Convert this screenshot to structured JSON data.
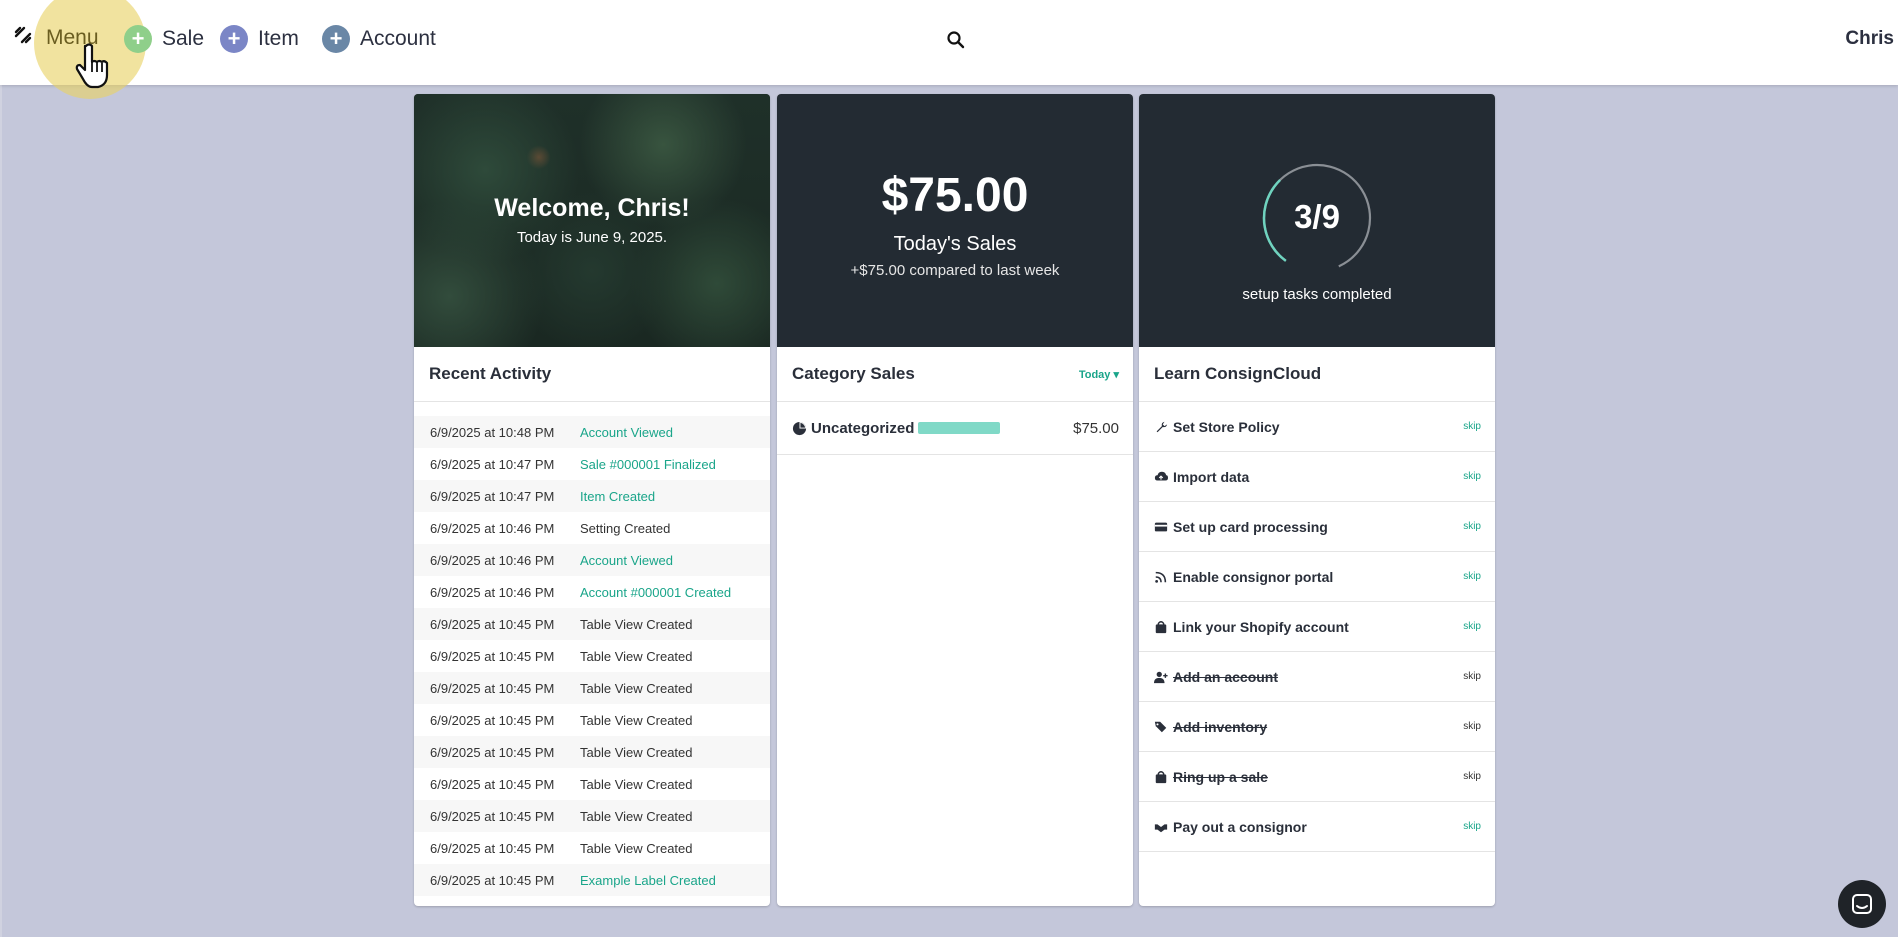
{
  "topbar": {
    "menu_label": "Menu",
    "quick_actions": [
      {
        "label": "Sale",
        "color": "#8fcf8a"
      },
      {
        "label": "Item",
        "color": "#7b86c6"
      },
      {
        "label": "Account",
        "color": "#6a87a6"
      }
    ],
    "user_name": "Chris"
  },
  "welcome": {
    "title": "Welcome, Chris!",
    "subtitle": "Today is June 9, 2025."
  },
  "sales": {
    "amount": "$75.00",
    "label": "Today's Sales",
    "compare": "+$75.00 compared to last week"
  },
  "setup": {
    "progress_text": "3/9",
    "completed": 3,
    "total": 9,
    "caption": "setup tasks completed"
  },
  "recent_activity": {
    "title": "Recent Activity",
    "rows": [
      {
        "date": "6/9/2025 at 10:48 PM",
        "text": "Account Viewed",
        "link": true
      },
      {
        "date": "6/9/2025 at 10:47 PM",
        "text": "Sale #000001 Finalized",
        "link": true
      },
      {
        "date": "6/9/2025 at 10:47 PM",
        "text": "Item Created",
        "link": true
      },
      {
        "date": "6/9/2025 at 10:46 PM",
        "text": "Setting Created",
        "link": false
      },
      {
        "date": "6/9/2025 at 10:46 PM",
        "text": "Account Viewed",
        "link": true
      },
      {
        "date": "6/9/2025 at 10:46 PM",
        "text": "Account #000001 Created",
        "link": true
      },
      {
        "date": "6/9/2025 at 10:45 PM",
        "text": "Table View Created",
        "link": false
      },
      {
        "date": "6/9/2025 at 10:45 PM",
        "text": "Table View Created",
        "link": false
      },
      {
        "date": "6/9/2025 at 10:45 PM",
        "text": "Table View Created",
        "link": false
      },
      {
        "date": "6/9/2025 at 10:45 PM",
        "text": "Table View Created",
        "link": false
      },
      {
        "date": "6/9/2025 at 10:45 PM",
        "text": "Table View Created",
        "link": false
      },
      {
        "date": "6/9/2025 at 10:45 PM",
        "text": "Table View Created",
        "link": false
      },
      {
        "date": "6/9/2025 at 10:45 PM",
        "text": "Table View Created",
        "link": false
      },
      {
        "date": "6/9/2025 at 10:45 PM",
        "text": "Table View Created",
        "link": false
      },
      {
        "date": "6/9/2025 at 10:45 PM",
        "text": "Example Label Created",
        "link": true
      }
    ]
  },
  "category_sales": {
    "title": "Category Sales",
    "period": "Today",
    "rows": [
      {
        "name": "Uncategorized",
        "amount": "$75.00",
        "share": 1.0
      }
    ]
  },
  "learn": {
    "title": "Learn ConsignCloud",
    "skip_label": "skip",
    "tasks": [
      {
        "label": "Set Store Policy",
        "icon": "wrench-icon",
        "done": false
      },
      {
        "label": "Import data",
        "icon": "cloud-upload-icon",
        "done": false
      },
      {
        "label": "Set up card processing",
        "icon": "credit-card-icon",
        "done": false
      },
      {
        "label": "Enable consignor portal",
        "icon": "rss-icon",
        "done": false
      },
      {
        "label": "Link your Shopify account",
        "icon": "shopping-bag-icon",
        "done": false
      },
      {
        "label": "Add an account",
        "icon": "user-plus-icon",
        "done": true
      },
      {
        "label": "Add inventory",
        "icon": "tags-icon",
        "done": true
      },
      {
        "label": "Ring up a sale",
        "icon": "bag-icon",
        "done": true
      },
      {
        "label": "Pay out a consignor",
        "icon": "handshake-icon",
        "done": false
      }
    ]
  },
  "colors": {
    "accent": "#1aa58a",
    "card_dark": "#232b33",
    "background": "#c4c7da"
  }
}
